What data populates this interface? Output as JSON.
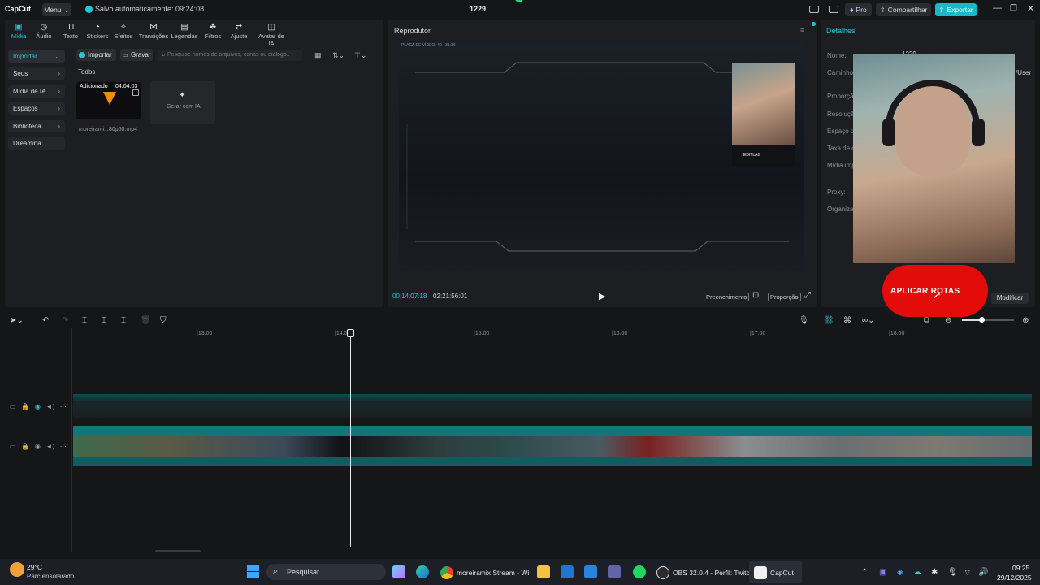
{
  "titlebar": {
    "app_name": "CapCut",
    "menu_label": "Menu",
    "autosave_text": "Salvo automaticamente: 09:24:08",
    "project_name": "1229",
    "pro_label": "Pro",
    "share_label": "Compartilhar",
    "export_label": "Exportar"
  },
  "toolbar": {
    "items": [
      {
        "label": "Mídia",
        "icon": "media-icon"
      },
      {
        "label": "Áudio",
        "icon": "audio-icon"
      },
      {
        "label": "Texto",
        "icon": "text-icon"
      },
      {
        "label": "Stickers",
        "icon": "stickers-icon"
      },
      {
        "label": "Efeitos",
        "icon": "effects-icon"
      },
      {
        "label": "Transições",
        "icon": "transitions-icon"
      },
      {
        "label": "Legendas",
        "icon": "captions-icon"
      },
      {
        "label": "Filtros",
        "icon": "filters-icon"
      },
      {
        "label": "Ajuste",
        "icon": "adjust-icon"
      },
      {
        "label": "Avatar de IA",
        "icon": "avatar-icon"
      }
    ]
  },
  "sidebar": {
    "items": [
      {
        "label": "Importar",
        "active": true
      },
      {
        "label": "Seus"
      },
      {
        "label": "Mídia de IA"
      },
      {
        "label": "Espaços"
      },
      {
        "label": "Biblioteca"
      },
      {
        "label": "Dreamina"
      }
    ]
  },
  "media": {
    "import_label": "Importar",
    "record_label": "Gravar",
    "search_placeholder": "Pesquise nomes de arquivos, cenas ou diálogo...",
    "section_title": "Todos",
    "clip_badge": "Adicionado",
    "clip_duration": "04:04:03",
    "clip_name": "moreirami...80p60.mp4",
    "generate_label": "Gerar com IA"
  },
  "player": {
    "title": "Reprodutor",
    "current_time": "00:14:07:18",
    "total_time": "02:21:56:01",
    "fill_label": "Preenchimento",
    "ratio_label": "Proporção",
    "overlay_top_text": "PLACA DE VÍDEO: 40 · 31:36",
    "cam_badge": "EDITLAG"
  },
  "details": {
    "title": "Detalhes",
    "rows": [
      "Nome:",
      "Caminho:",
      "Proporção:",
      "Resolução:",
      "Espaço d",
      "Taxa de c",
      "Mídia imp",
      "Proxy:",
      "Organizar"
    ],
    "name_value": "1229",
    "path_value": "/User",
    "modify_label": "Modificar",
    "overlay_button": "APLICAR ROTAS"
  },
  "timeline": {
    "ruler": [
      "|13:00",
      "|14:00",
      "|15:00",
      "|16:00",
      "|17:00",
      "|18:00"
    ],
    "playhead_fraction": 0.289
  },
  "taskbar": {
    "weather_temp": "29°C",
    "weather_desc": "Parc ensolarado",
    "search_label": "Pesquisar",
    "apps": [
      {
        "label": "moreiramix Stream - Wi"
      },
      {
        "label": "OBS 32.0.4 - Perfil: Twitc"
      },
      {
        "label": "CapCut"
      }
    ],
    "time": "09:25",
    "date": "29/12/2025"
  },
  "colors": {
    "accent": "#26c6d8",
    "export_button": "#19b9c9",
    "overlay_red": "#e40b0b"
  }
}
